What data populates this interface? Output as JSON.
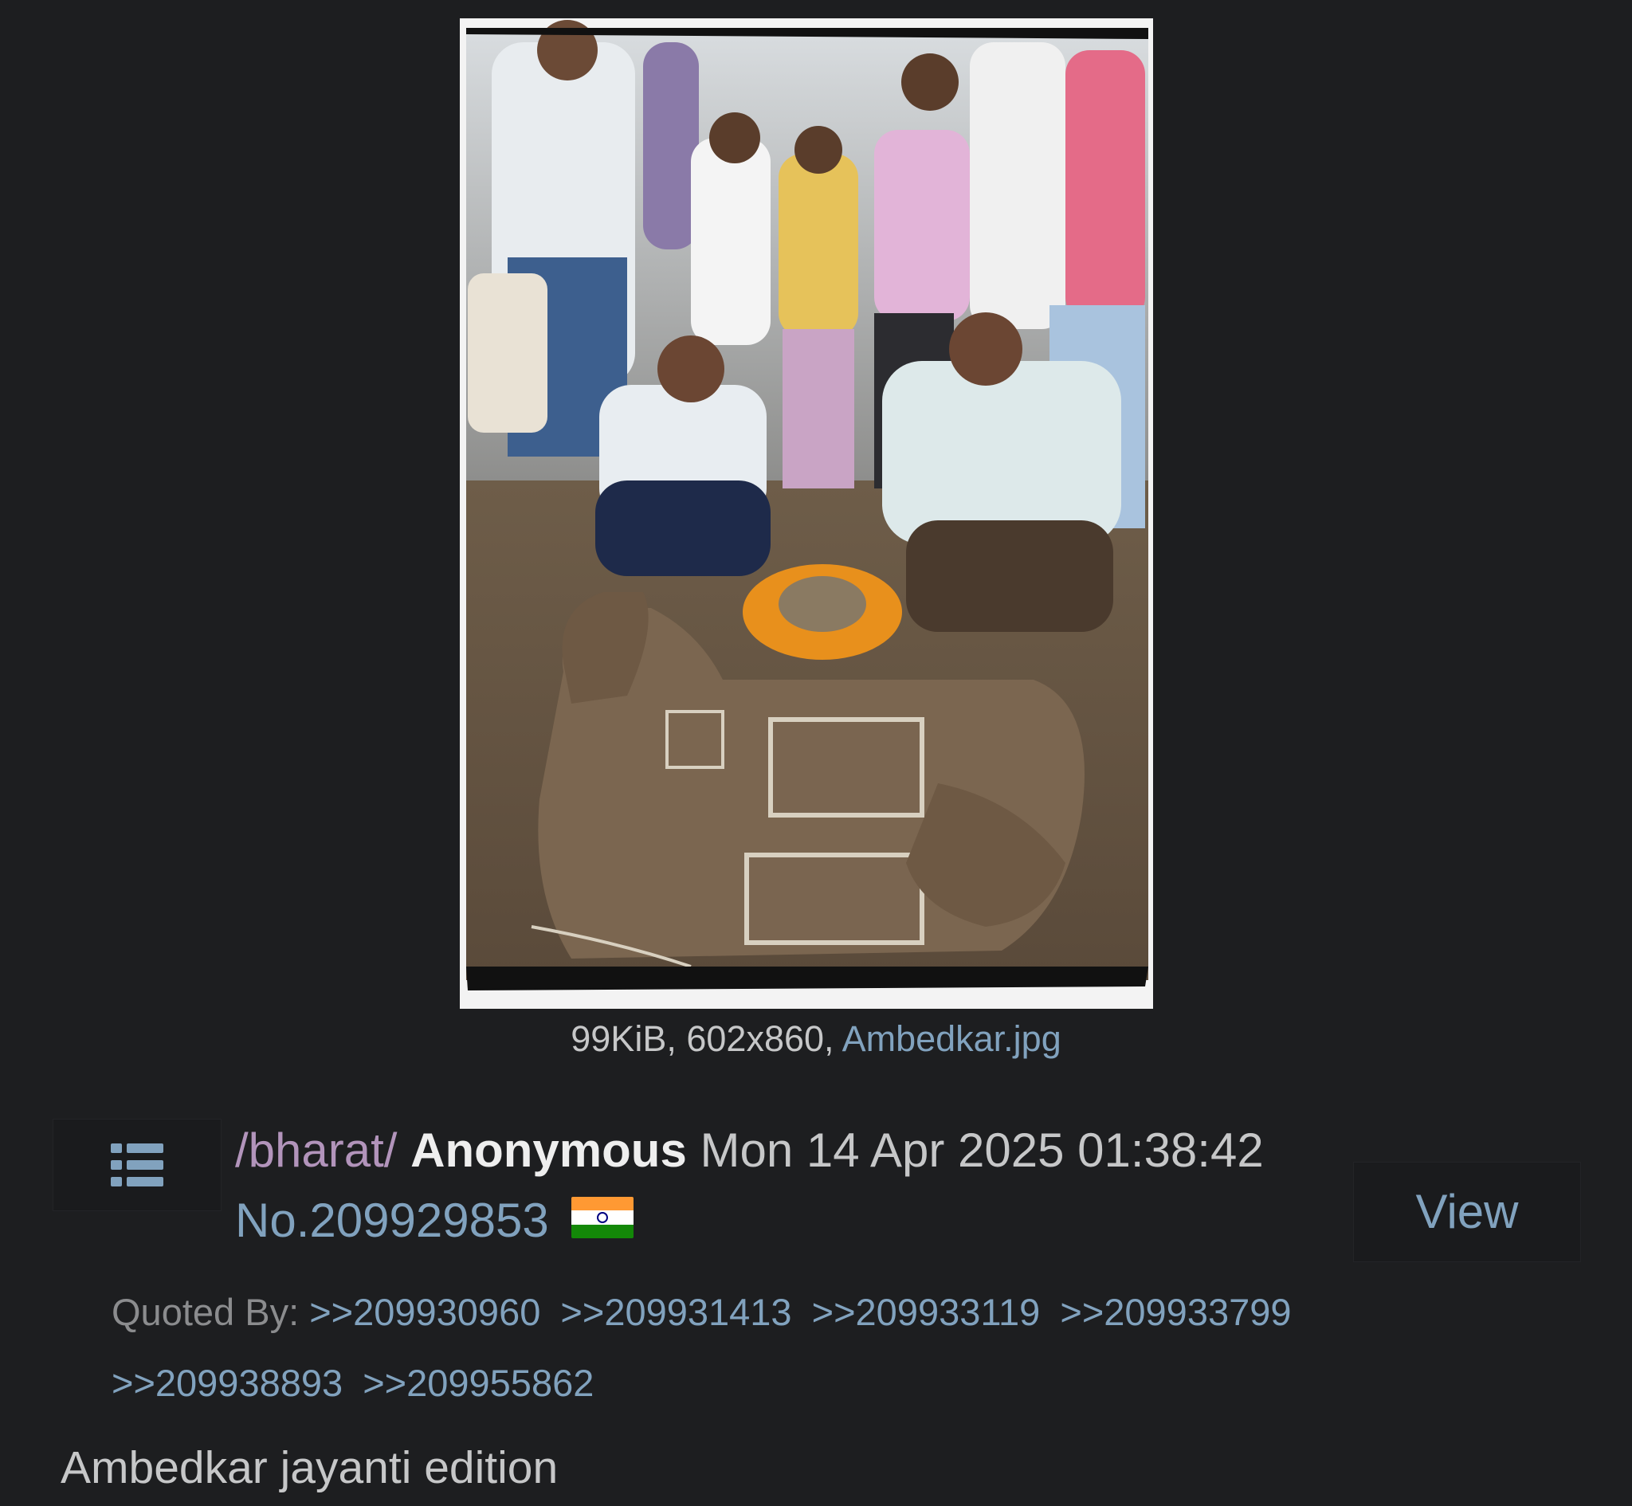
{
  "image": {
    "alt_icon": "photo-thumbnail",
    "file_size": "99KiB",
    "dimensions": "602x860",
    "filename": "Ambedkar.jpg"
  },
  "post": {
    "menu_icon": "list-menu-icon",
    "board": "/bharat/",
    "name": "Anonymous",
    "date": "Mon 14 Apr 2025 01:38:42",
    "number": "No.209929853",
    "flag": "india-flag-icon",
    "view_label": "View",
    "quoted_by_label": "Quoted By:",
    "quoted_by": [
      ">>209930960",
      ">>209931413",
      ">>209933119",
      ">>209933799",
      ">>209938893",
      ">>209955862"
    ],
    "body": "Ambedkar jayanti edition"
  },
  "colors": {
    "background": "#1d1e20",
    "link": "#81a2be",
    "board": "#b294bb",
    "name": "#eeeeee",
    "text": "#c6c7c8"
  }
}
